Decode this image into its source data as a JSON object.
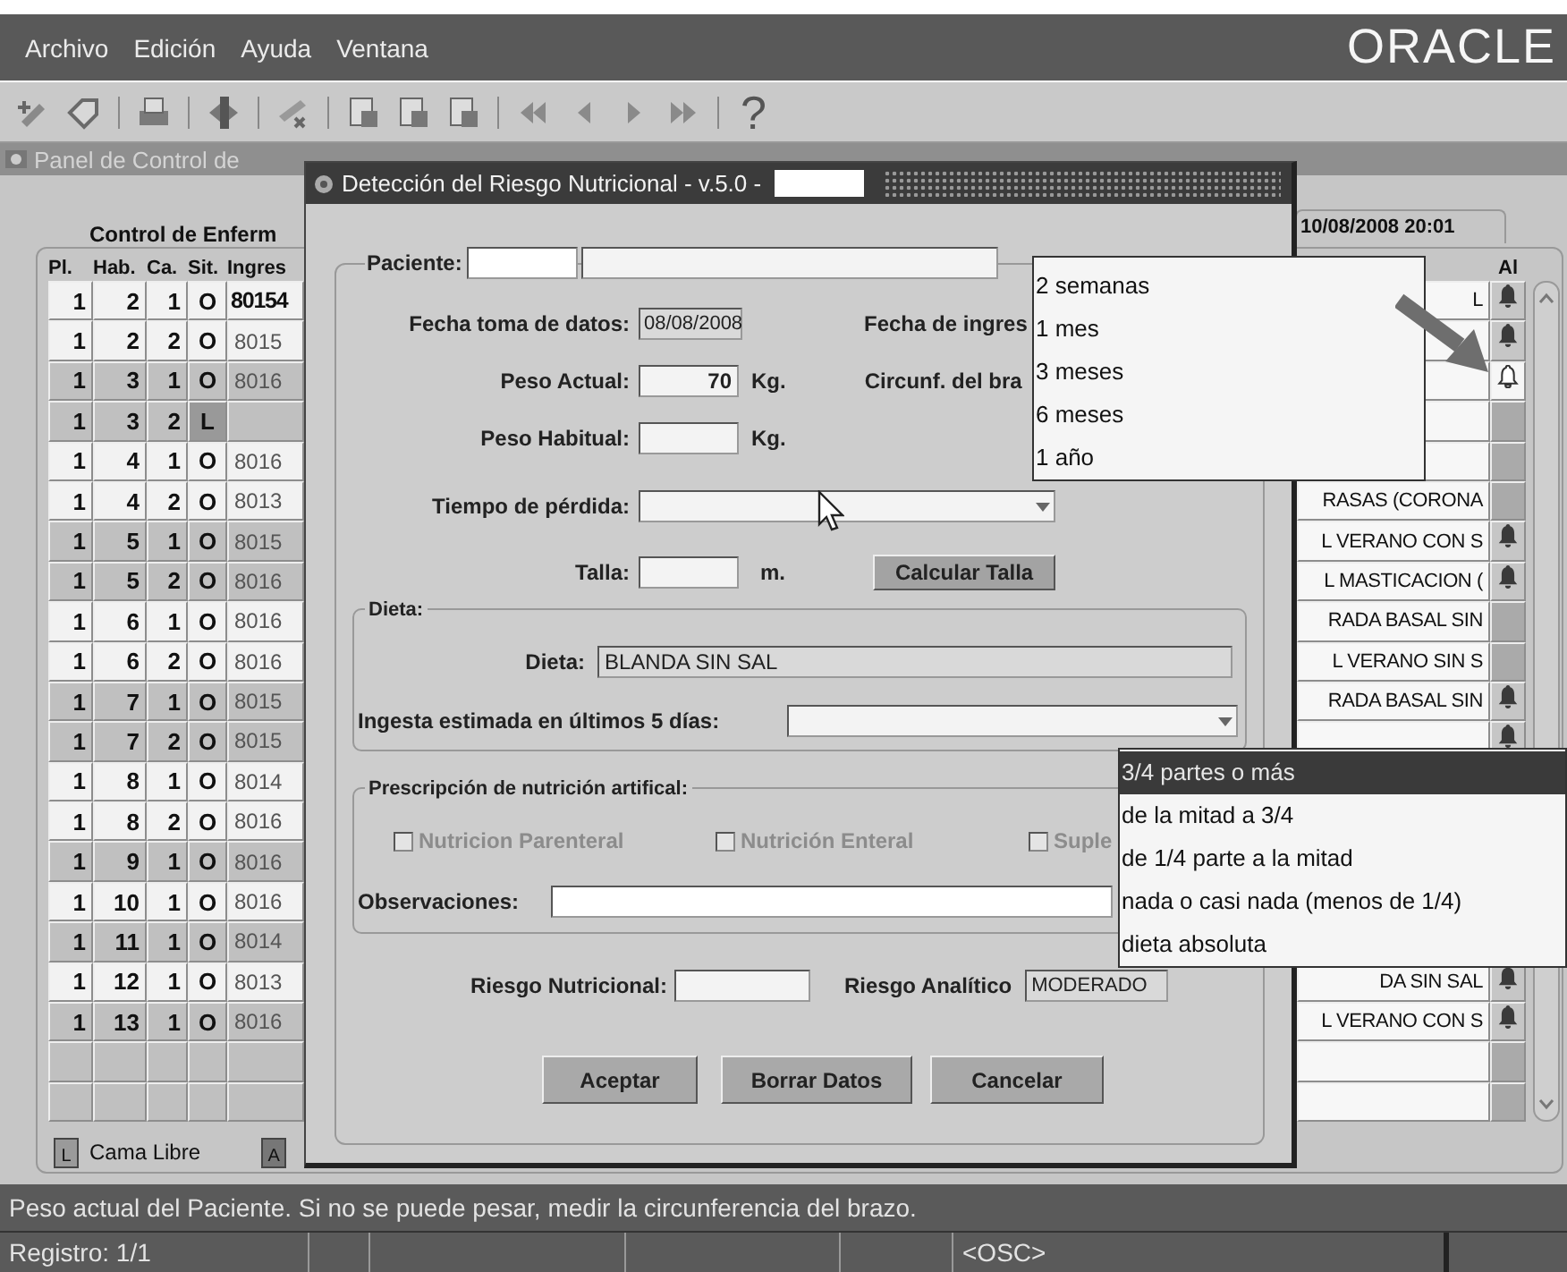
{
  "menu_bar": {
    "items": [
      "Archivo",
      "Edición",
      "Ayuda",
      "Ventana"
    ],
    "logo": "ORACLE"
  },
  "toolbar": {
    "help": "?"
  },
  "panel": {
    "title": "Panel de Control de",
    "section_title": "Control de Enferm",
    "timestamp": "10/08/2008 20:01",
    "columns": [
      "Pl.",
      "Hab.",
      "Ca.",
      "Sit.",
      "Ingres"
    ],
    "alarm_column": "Al",
    "rows": [
      {
        "pl": "1",
        "hab": "2",
        "ca": "1",
        "sit": "O",
        "ingreso": "80154",
        "diet": "L",
        "kind": "bell",
        "shaded": false,
        "current": true,
        "free": false
      },
      {
        "pl": "1",
        "hab": "2",
        "ca": "2",
        "sit": "O",
        "ingreso": "8015",
        "kind": "bell",
        "shaded": false,
        "current": false,
        "free": false
      },
      {
        "pl": "1",
        "hab": "3",
        "ca": "1",
        "sit": "O",
        "ingreso": "8016",
        "kind": "bell-outline",
        "shaded": true,
        "current": false,
        "free": false
      },
      {
        "pl": "1",
        "hab": "3",
        "ca": "2",
        "sit": "L",
        "kind": "none",
        "shaded": true,
        "current": false,
        "free": true
      },
      {
        "pl": "1",
        "hab": "4",
        "ca": "1",
        "sit": "O",
        "ingreso": "8016",
        "kind": "none",
        "shaded": false,
        "current": false,
        "free": false
      },
      {
        "pl": "1",
        "hab": "4",
        "ca": "2",
        "sit": "O",
        "ingreso": "8013",
        "diet": "RASAS (CORONA",
        "kind": "none",
        "shaded": false,
        "current": false,
        "free": false
      },
      {
        "pl": "1",
        "hab": "5",
        "ca": "1",
        "sit": "O",
        "ingreso": "8015",
        "diet": "L VERANO CON S",
        "kind": "bell",
        "shaded": true,
        "current": false,
        "free": false
      },
      {
        "pl": "1",
        "hab": "5",
        "ca": "2",
        "sit": "O",
        "ingreso": "8016",
        "diet": "L MASTICACION (",
        "kind": "bell",
        "shaded": true,
        "current": false,
        "free": false
      },
      {
        "pl": "1",
        "hab": "6",
        "ca": "1",
        "sit": "O",
        "ingreso": "8016",
        "diet": "RADA BASAL SIN",
        "kind": "none",
        "shaded": false,
        "current": false,
        "free": false
      },
      {
        "pl": "1",
        "hab": "6",
        "ca": "2",
        "sit": "O",
        "ingreso": "8016",
        "diet": "L VERANO SIN S",
        "kind": "none",
        "shaded": false,
        "current": false,
        "free": false
      },
      {
        "pl": "1",
        "hab": "7",
        "ca": "1",
        "sit": "O",
        "ingreso": "8015",
        "diet": "RADA BASAL SIN",
        "kind": "bell",
        "shaded": true,
        "current": false,
        "free": false
      },
      {
        "pl": "1",
        "hab": "7",
        "ca": "2",
        "sit": "O",
        "ingreso": "8015",
        "kind": "bell",
        "shaded": true,
        "current": false,
        "free": false
      },
      {
        "pl": "1",
        "hab": "8",
        "ca": "1",
        "sit": "O",
        "ingreso": "8014",
        "shaded": false,
        "current": false,
        "free": false
      },
      {
        "pl": "1",
        "hab": "8",
        "ca": "2",
        "sit": "O",
        "ingreso": "8016",
        "shaded": false,
        "current": false,
        "free": false
      },
      {
        "pl": "1",
        "hab": "9",
        "ca": "1",
        "sit": "O",
        "ingreso": "8016",
        "shaded": true,
        "current": false,
        "free": false
      },
      {
        "pl": "1",
        "hab": "10",
        "ca": "1",
        "sit": "O",
        "ingreso": "8016",
        "shaded": false,
        "current": false,
        "free": false
      },
      {
        "pl": "1",
        "hab": "11",
        "ca": "1",
        "sit": "O",
        "ingreso": "8014",
        "shaded": true,
        "current": false,
        "free": false
      },
      {
        "pl": "1",
        "hab": "12",
        "ca": "1",
        "sit": "O",
        "ingreso": "8013",
        "diet": "DA SIN SAL",
        "kind": "bell",
        "shaded": false,
        "current": false,
        "free": false
      },
      {
        "pl": "1",
        "hab": "13",
        "ca": "1",
        "sit": "O",
        "ingreso": "8016",
        "diet": "L VERANO CON S",
        "kind": "bell",
        "shaded": true,
        "current": false,
        "free": false
      },
      {
        "kind": "none",
        "shaded": true,
        "current": false,
        "free": false
      },
      {
        "kind": "none",
        "shaded": true,
        "current": false,
        "free": false
      }
    ],
    "legend": [
      {
        "key": "L",
        "label": "Cama Libre"
      },
      {
        "key": "A"
      }
    ]
  },
  "dialog": {
    "title": "Detección del Riesgo Nutricional - v.5.0 -",
    "patient_label": "Paciente:",
    "date_label": "Fecha toma de datos:",
    "date_value": "08/08/2008",
    "admission_label": "Fecha de ingres",
    "weight_label": "Peso Actual:",
    "weight_value": "70",
    "weight_unit": "Kg.",
    "arm_label": "Circunf. del bra",
    "usual_weight_label": "Peso Habitual:",
    "usual_weight_unit": "Kg.",
    "loss_time_label": "Tiempo de pérdida:",
    "height_label": "Talla:",
    "height_unit": "m.",
    "calc_button": "Calcular Talla",
    "diet_group": "Dieta:",
    "diet_label": "Dieta:",
    "diet_value": "BLANDA SIN SAL",
    "intake_label": "Ingesta estimada en últimos 5 días:",
    "prescription_group": "Prescripción de nutrición artifical:",
    "options": [
      {
        "label": "Nutricion Parenteral",
        "checked": false,
        "disabled": true
      },
      {
        "label": "Nutrición Enteral",
        "checked": false,
        "disabled": true
      },
      {
        "label": "Suple",
        "checked": false,
        "disabled": true
      }
    ],
    "notes_label": "Observaciones:",
    "risk_label": "Riesgo Nutricional:",
    "lab_risk_label": "Riesgo Analítico",
    "lab_risk_value": "MODERADO",
    "buttons": [
      "Aceptar",
      "Borrar Datos",
      "Cancelar"
    ]
  },
  "time_dropdown": {
    "options": [
      {
        "label": "2 semanas",
        "selected": false
      },
      {
        "label": "1 mes",
        "selected": false
      },
      {
        "label": "3 meses",
        "selected": false
      },
      {
        "label": "6 meses",
        "selected": false
      },
      {
        "label": "1 año",
        "selected": false
      }
    ]
  },
  "intake_dropdown": {
    "options": [
      {
        "label": "3/4 partes o más",
        "selected": true
      },
      {
        "label": "de la mitad a 3/4",
        "selected": false
      },
      {
        "label": "de 1/4 parte a la mitad",
        "selected": false
      },
      {
        "label": "nada o casi nada (menos de 1/4)",
        "selected": false
      },
      {
        "label": "dieta absoluta",
        "selected": false
      }
    ]
  },
  "status_bar": {
    "message": "Peso actual del Paciente. Si no se puede pesar, medir la circunferencia del brazo.",
    "record": "Registro: 1/1",
    "mode": "<OSC>"
  }
}
